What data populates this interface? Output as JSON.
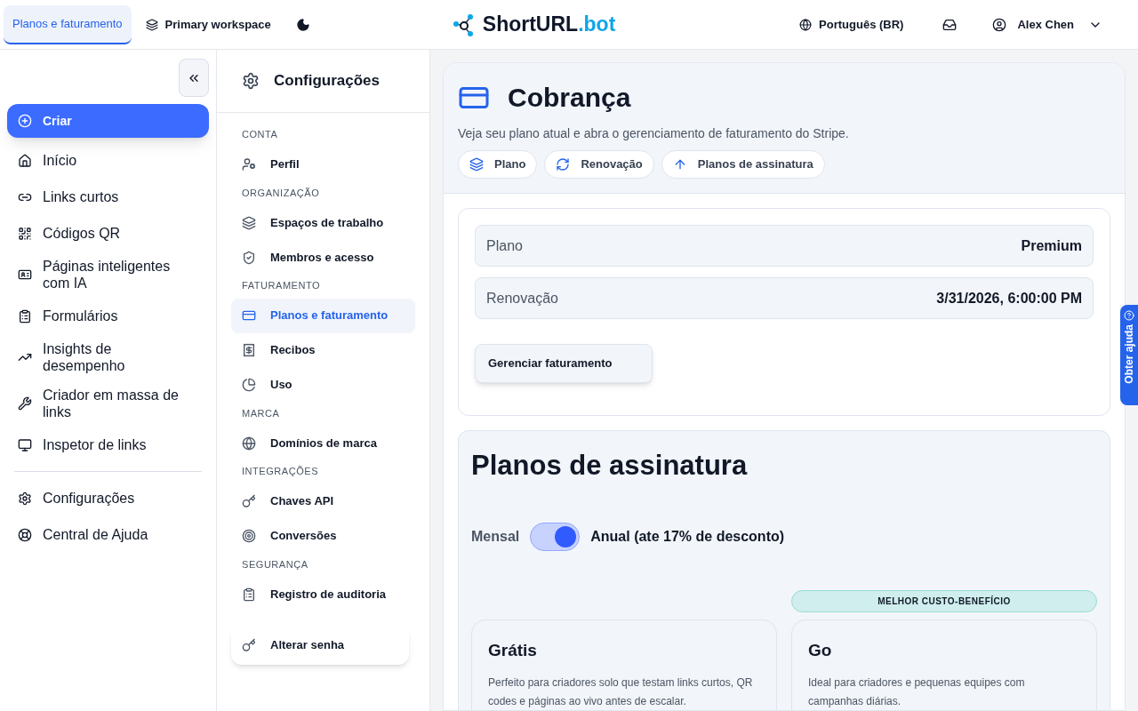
{
  "topbar": {
    "tab": {
      "label": "Planos e faturamento",
      "selected": true
    },
    "workspace": "Primary workspace",
    "logo": {
      "name": "ShortURL",
      "suffix": ".bot"
    },
    "language": "Português (BR)",
    "user": "Alex Chen"
  },
  "sidebar": {
    "create": "Criar",
    "items": [
      {
        "label": "Início"
      },
      {
        "label": "Links curtos"
      },
      {
        "label": "Códigos QR"
      },
      {
        "label": "Páginas inteligentes com IA"
      },
      {
        "label": "Formulários"
      },
      {
        "label": "Insights de desempenho"
      },
      {
        "label": "Criador em massa de links"
      },
      {
        "label": "Inspetor de links"
      }
    ],
    "footer": [
      {
        "label": "Configurações"
      },
      {
        "label": "Central de Ajuda"
      }
    ]
  },
  "settings": {
    "title": "Configurações",
    "sections": [
      {
        "heading": "CONTA",
        "items": [
          {
            "label": "Perfil",
            "selected": false
          }
        ]
      },
      {
        "heading": "ORGANIZAÇÃO",
        "items": [
          {
            "label": "Espaços de trabalho",
            "selected": false
          },
          {
            "label": "Membros e acesso",
            "selected": false
          }
        ]
      },
      {
        "heading": "FATURAMENTO",
        "items": [
          {
            "label": "Planos e faturamento",
            "selected": true
          },
          {
            "label": "Recibos",
            "selected": false
          },
          {
            "label": "Uso",
            "selected": false
          }
        ]
      },
      {
        "heading": "MARCA",
        "items": [
          {
            "label": "Domínios de marca",
            "selected": false
          }
        ]
      },
      {
        "heading": "INTEGRAÇÕES",
        "items": [
          {
            "label": "Chaves API",
            "selected": false
          },
          {
            "label": "Conversões",
            "selected": false
          }
        ]
      },
      {
        "heading": "SEGURANÇA",
        "items": [
          {
            "label": "Registro de auditoria",
            "selected": false
          }
        ]
      }
    ],
    "change_password": "Alterar senha"
  },
  "billing": {
    "title": "Cobrança",
    "subtitle": "Veja seu plano atual e abra o gerenciamento de faturamento do Stripe.",
    "chips": [
      {
        "label": "Plano"
      },
      {
        "label": "Renovação"
      },
      {
        "label": "Planos de assinatura"
      }
    ],
    "rows": [
      {
        "label": "Plano",
        "value": "Premium"
      },
      {
        "label": "Renovação",
        "value": "3/31/2026, 6:00:00 PM"
      }
    ],
    "manage_button": "Gerenciar faturamento"
  },
  "plans": {
    "title": "Planos de assinatura",
    "monthly": "Mensal",
    "annual": "Anual (ate 17% de desconto)",
    "annual_on": true,
    "cards": [
      {
        "name": "Grátis",
        "description": "Perfeito para criadores solo que testam links curtos, QR codes e páginas ao vivo antes de escalar."
      },
      {
        "badge": "MELHOR CUSTO-BENEFÍCIO",
        "name": "Go",
        "description": "Ideal para criadores e pequenas equipes com campanhas diárias."
      }
    ]
  },
  "help_tab": "Obter ajuda"
}
